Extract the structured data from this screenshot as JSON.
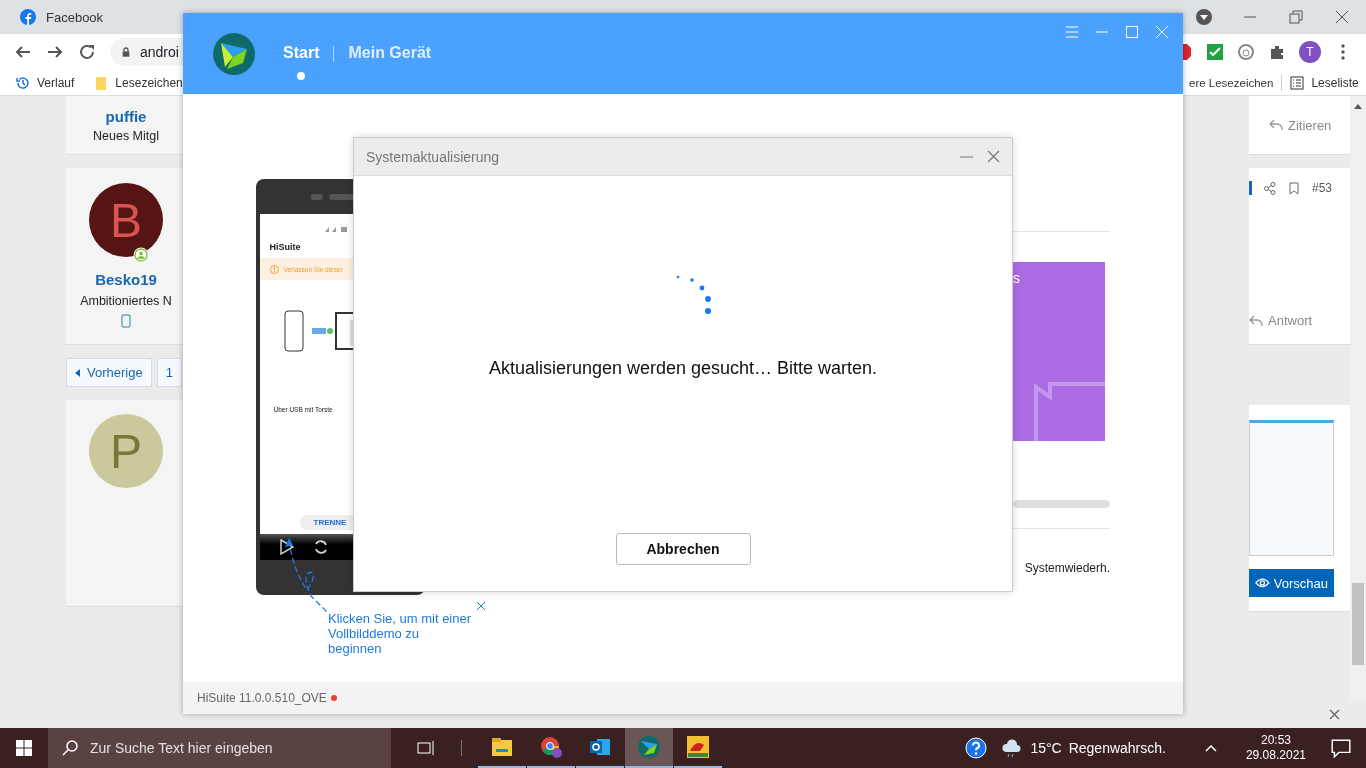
{
  "browser": {
    "tabs": [
      {
        "title": "Facebook",
        "selected": false
      }
    ],
    "address": "androi",
    "profile_initial": "T",
    "bookmarks": [
      "Verlauf",
      "Lesezeichen"
    ],
    "bookmarks_right": [
      "ere Lesezeichen",
      "Leseliste"
    ]
  },
  "forum": {
    "posts_left": [
      {
        "author": "puffie",
        "rank": "Neues Mitgl"
      },
      {
        "avatar_letter": "B",
        "author": "Besko19",
        "rank": "Ambitioniertes N"
      }
    ],
    "pagination": {
      "previous": "Vorherige",
      "pages": [
        "1"
      ]
    },
    "reply_avatar": {
      "avatar_letter": "P"
    },
    "actions_right": [
      {
        "label": "Zitieren"
      },
      {
        "post_number": "#53",
        "label": "Antwort"
      }
    ],
    "preview_button": "Vorschau"
  },
  "hisuite": {
    "nav": [
      {
        "label": "Start",
        "selected": true
      },
      {
        "label": "Mein Gerät",
        "selected": false
      }
    ],
    "phone": {
      "app_title": "HiSuite",
      "warning": "Verlassen Sie dieser",
      "caption": "Über USB mit Torste",
      "disconnect": "TRENNE"
    },
    "tooltip": "Klicken Sie, um mit einer Vollbilddemo zu beginnen",
    "card_text": "s",
    "status_label": "Systemwiederh.",
    "version": "HiSuite 11.0.0.510_OVE",
    "update_available": true
  },
  "dialog": {
    "title": "Systemaktualisierung",
    "message": "Aktualisierungen werden gesucht… Bitte warten.",
    "cancel": "Abbrechen"
  },
  "taskbar": {
    "search_placeholder": "Zur Suche Text hier eingeben",
    "apps": [
      {
        "kind": "files",
        "selected": false
      },
      {
        "kind": "chrome",
        "selected": false
      },
      {
        "kind": "outlook",
        "selected": false
      },
      {
        "kind": "hisuite",
        "selected": true
      },
      {
        "kind": "game",
        "selected": false
      }
    ],
    "temperature": "15°C",
    "weather": "Regenwahrsch.",
    "time": "20:53",
    "date": "29.08.2021"
  }
}
